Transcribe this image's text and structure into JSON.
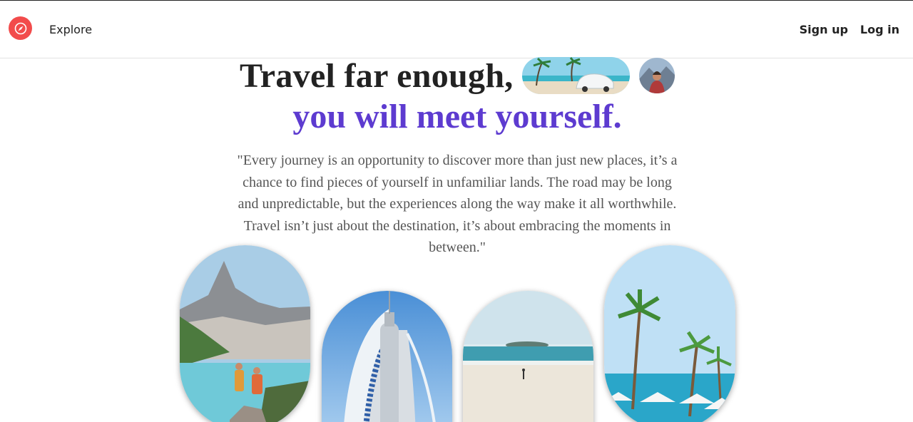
{
  "nav": {
    "logo_icon": "compass-icon",
    "explore_label": "Explore",
    "signup_label": "Sign up",
    "login_label": "Log in"
  },
  "hero": {
    "line1": "Travel far enough,",
    "line2": "you will meet yourself.",
    "quote": "\"Every journey is an opportunity to discover more than just new places, it’s a chance to find pieces of yourself in unfamiliar lands. The road may be long and unpredictable, but the experiences along the way make it all worthwhile. Travel isn’t just about the destination, it’s about embracing the moments in between.\""
  },
  "colors": {
    "brand": "#f24b4b",
    "accent": "#5d3bd0",
    "text": "#222222",
    "quote": "#555555"
  }
}
